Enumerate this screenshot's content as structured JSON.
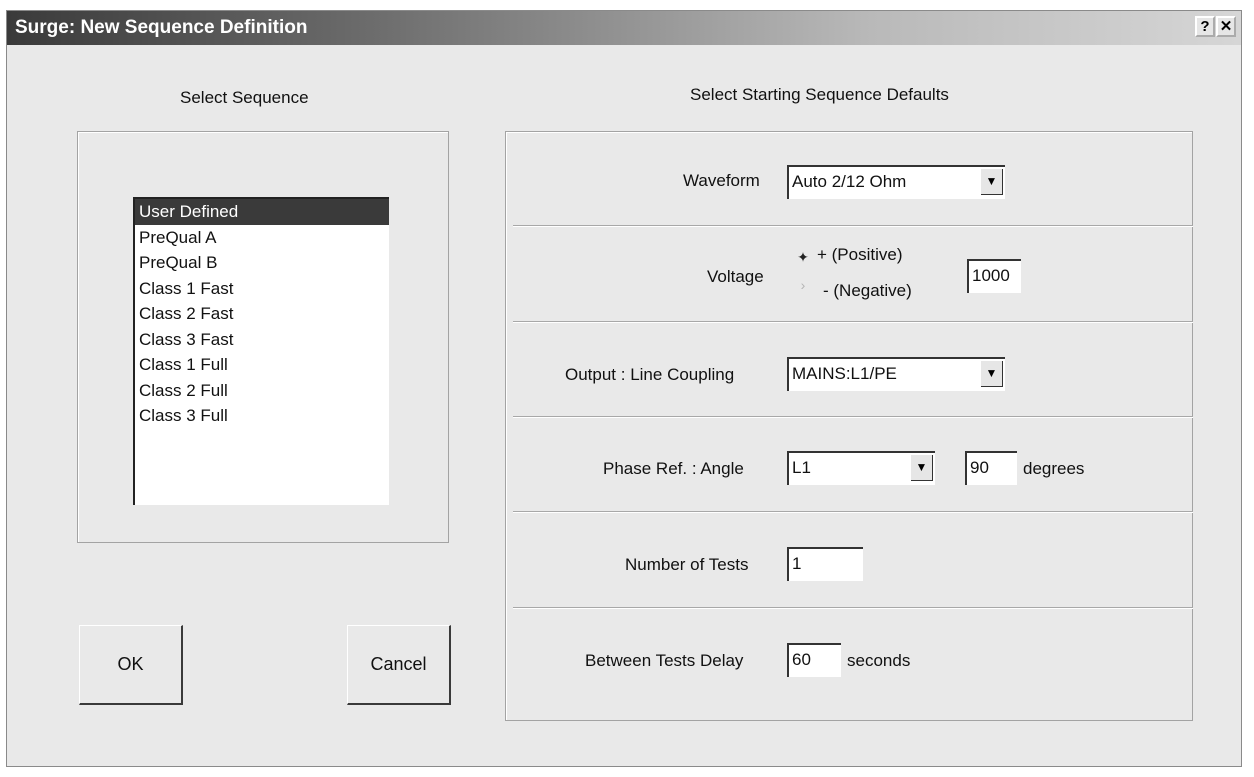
{
  "window": {
    "title": "Surge: New Sequence Definition",
    "help_label": "?",
    "close_label": "✕"
  },
  "left": {
    "header": "Select Sequence",
    "sequences": [
      {
        "label": "User Defined",
        "selected": true
      },
      {
        "label": "PreQual A"
      },
      {
        "label": "PreQual B"
      },
      {
        "label": "Class 1 Fast"
      },
      {
        "label": "Class 2 Fast"
      },
      {
        "label": "Class 3 Fast"
      },
      {
        "label": "Class 1 Full"
      },
      {
        "label": "Class 2 Full"
      },
      {
        "label": "Class 3 Full"
      }
    ],
    "ok_label": "OK",
    "cancel_label": "Cancel"
  },
  "right": {
    "header": "Select Starting Sequence Defaults",
    "waveform": {
      "label": "Waveform",
      "value": "Auto 2/12 Ohm"
    },
    "voltage": {
      "label": "Voltage",
      "positive_label": "+ (Positive)",
      "negative_label": "- (Negative)",
      "polarity": "positive",
      "value": "1000"
    },
    "output": {
      "label": "Output : Line Coupling",
      "value": "MAINS:L1/PE"
    },
    "phase": {
      "label": "Phase Ref. : Angle",
      "ref_value": "L1",
      "angle_value": "90",
      "unit": "degrees"
    },
    "tests": {
      "label": "Number of Tests",
      "value": "1"
    },
    "delay": {
      "label": "Between Tests Delay",
      "value": "60",
      "unit": "seconds"
    }
  },
  "icons": {
    "dropdown": "chevron-down-icon",
    "radio_on": "radio-selected-icon",
    "radio_off": "radio-unselected-icon"
  }
}
